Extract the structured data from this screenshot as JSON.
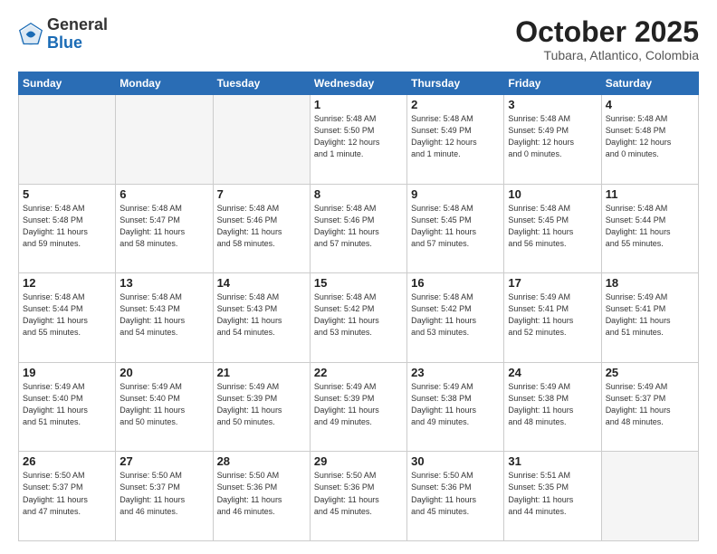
{
  "header": {
    "logo_general": "General",
    "logo_blue": "Blue",
    "month_title": "October 2025",
    "subtitle": "Tubara, Atlantico, Colombia"
  },
  "days_of_week": [
    "Sunday",
    "Monday",
    "Tuesday",
    "Wednesday",
    "Thursday",
    "Friday",
    "Saturday"
  ],
  "weeks": [
    [
      {
        "day": "",
        "info": ""
      },
      {
        "day": "",
        "info": ""
      },
      {
        "day": "",
        "info": ""
      },
      {
        "day": "1",
        "info": "Sunrise: 5:48 AM\nSunset: 5:50 PM\nDaylight: 12 hours\nand 1 minute."
      },
      {
        "day": "2",
        "info": "Sunrise: 5:48 AM\nSunset: 5:49 PM\nDaylight: 12 hours\nand 1 minute."
      },
      {
        "day": "3",
        "info": "Sunrise: 5:48 AM\nSunset: 5:49 PM\nDaylight: 12 hours\nand 0 minutes."
      },
      {
        "day": "4",
        "info": "Sunrise: 5:48 AM\nSunset: 5:48 PM\nDaylight: 12 hours\nand 0 minutes."
      }
    ],
    [
      {
        "day": "5",
        "info": "Sunrise: 5:48 AM\nSunset: 5:48 PM\nDaylight: 11 hours\nand 59 minutes."
      },
      {
        "day": "6",
        "info": "Sunrise: 5:48 AM\nSunset: 5:47 PM\nDaylight: 11 hours\nand 58 minutes."
      },
      {
        "day": "7",
        "info": "Sunrise: 5:48 AM\nSunset: 5:46 PM\nDaylight: 11 hours\nand 58 minutes."
      },
      {
        "day": "8",
        "info": "Sunrise: 5:48 AM\nSunset: 5:46 PM\nDaylight: 11 hours\nand 57 minutes."
      },
      {
        "day": "9",
        "info": "Sunrise: 5:48 AM\nSunset: 5:45 PM\nDaylight: 11 hours\nand 57 minutes."
      },
      {
        "day": "10",
        "info": "Sunrise: 5:48 AM\nSunset: 5:45 PM\nDaylight: 11 hours\nand 56 minutes."
      },
      {
        "day": "11",
        "info": "Sunrise: 5:48 AM\nSunset: 5:44 PM\nDaylight: 11 hours\nand 55 minutes."
      }
    ],
    [
      {
        "day": "12",
        "info": "Sunrise: 5:48 AM\nSunset: 5:44 PM\nDaylight: 11 hours\nand 55 minutes."
      },
      {
        "day": "13",
        "info": "Sunrise: 5:48 AM\nSunset: 5:43 PM\nDaylight: 11 hours\nand 54 minutes."
      },
      {
        "day": "14",
        "info": "Sunrise: 5:48 AM\nSunset: 5:43 PM\nDaylight: 11 hours\nand 54 minutes."
      },
      {
        "day": "15",
        "info": "Sunrise: 5:48 AM\nSunset: 5:42 PM\nDaylight: 11 hours\nand 53 minutes."
      },
      {
        "day": "16",
        "info": "Sunrise: 5:48 AM\nSunset: 5:42 PM\nDaylight: 11 hours\nand 53 minutes."
      },
      {
        "day": "17",
        "info": "Sunrise: 5:49 AM\nSunset: 5:41 PM\nDaylight: 11 hours\nand 52 minutes."
      },
      {
        "day": "18",
        "info": "Sunrise: 5:49 AM\nSunset: 5:41 PM\nDaylight: 11 hours\nand 51 minutes."
      }
    ],
    [
      {
        "day": "19",
        "info": "Sunrise: 5:49 AM\nSunset: 5:40 PM\nDaylight: 11 hours\nand 51 minutes."
      },
      {
        "day": "20",
        "info": "Sunrise: 5:49 AM\nSunset: 5:40 PM\nDaylight: 11 hours\nand 50 minutes."
      },
      {
        "day": "21",
        "info": "Sunrise: 5:49 AM\nSunset: 5:39 PM\nDaylight: 11 hours\nand 50 minutes."
      },
      {
        "day": "22",
        "info": "Sunrise: 5:49 AM\nSunset: 5:39 PM\nDaylight: 11 hours\nand 49 minutes."
      },
      {
        "day": "23",
        "info": "Sunrise: 5:49 AM\nSunset: 5:38 PM\nDaylight: 11 hours\nand 49 minutes."
      },
      {
        "day": "24",
        "info": "Sunrise: 5:49 AM\nSunset: 5:38 PM\nDaylight: 11 hours\nand 48 minutes."
      },
      {
        "day": "25",
        "info": "Sunrise: 5:49 AM\nSunset: 5:37 PM\nDaylight: 11 hours\nand 48 minutes."
      }
    ],
    [
      {
        "day": "26",
        "info": "Sunrise: 5:50 AM\nSunset: 5:37 PM\nDaylight: 11 hours\nand 47 minutes."
      },
      {
        "day": "27",
        "info": "Sunrise: 5:50 AM\nSunset: 5:37 PM\nDaylight: 11 hours\nand 46 minutes."
      },
      {
        "day": "28",
        "info": "Sunrise: 5:50 AM\nSunset: 5:36 PM\nDaylight: 11 hours\nand 46 minutes."
      },
      {
        "day": "29",
        "info": "Sunrise: 5:50 AM\nSunset: 5:36 PM\nDaylight: 11 hours\nand 45 minutes."
      },
      {
        "day": "30",
        "info": "Sunrise: 5:50 AM\nSunset: 5:36 PM\nDaylight: 11 hours\nand 45 minutes."
      },
      {
        "day": "31",
        "info": "Sunrise: 5:51 AM\nSunset: 5:35 PM\nDaylight: 11 hours\nand 44 minutes."
      },
      {
        "day": "",
        "info": ""
      }
    ]
  ]
}
